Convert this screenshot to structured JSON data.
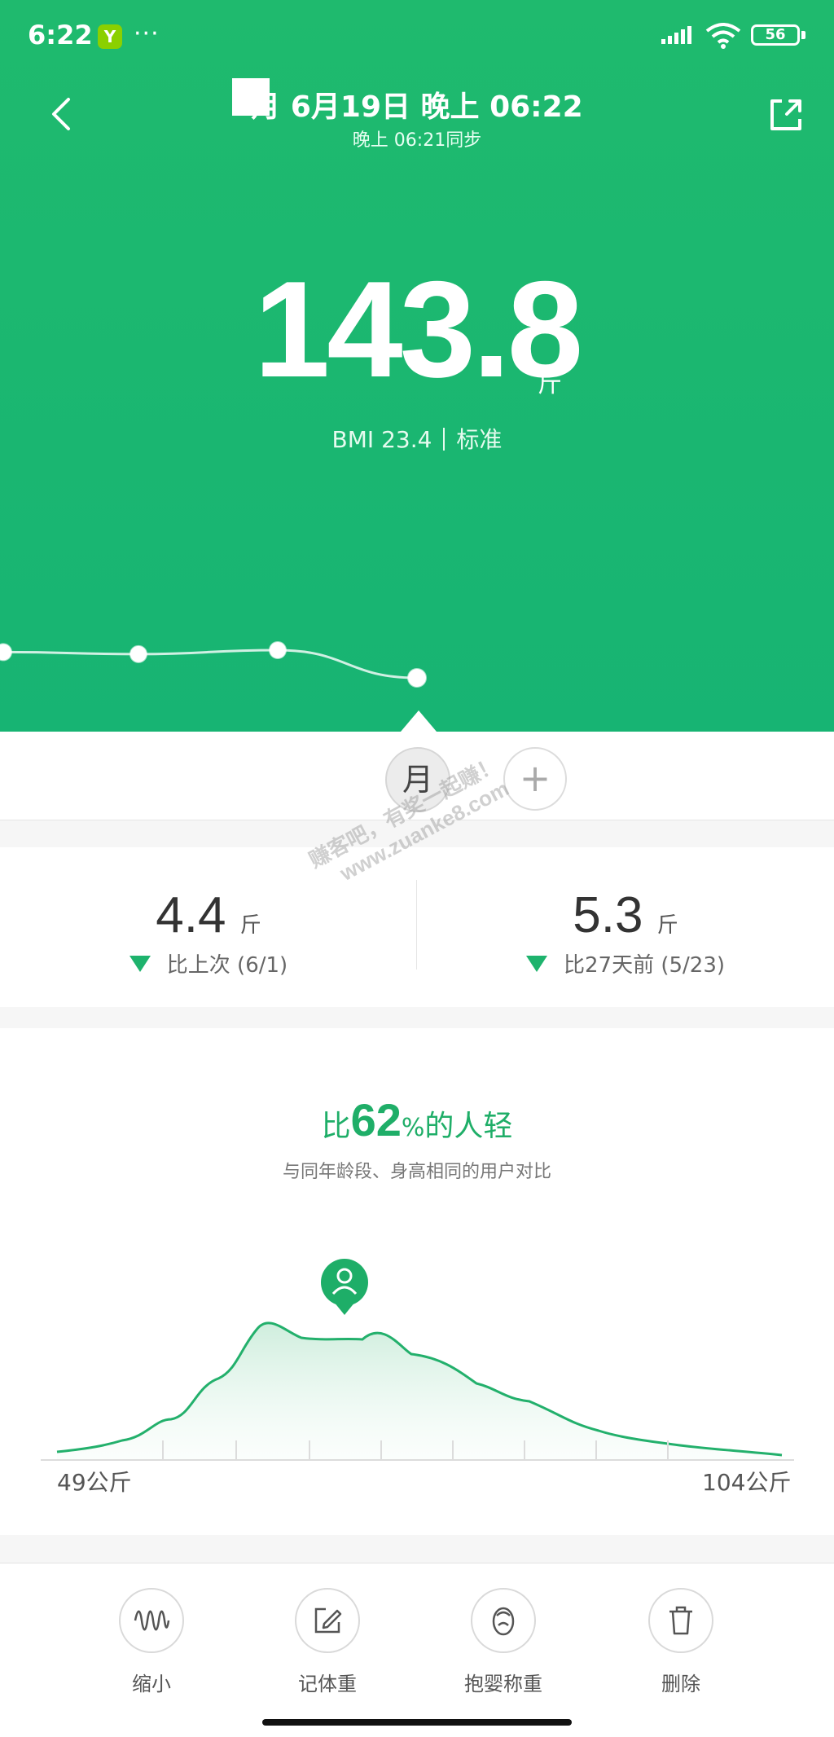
{
  "status_bar": {
    "time": "6:22",
    "app_badge": "Y",
    "more": "···",
    "battery": "56"
  },
  "header": {
    "title": "月 6月19日 晚上 06:22",
    "sync_text": "晚上 06:21同步"
  },
  "measurement": {
    "weight": "143.8",
    "unit": "斤",
    "bmi_label": "BMI 23.4",
    "bmi_status": "标准"
  },
  "trend": {
    "points": [
      {
        "label": "prev-3",
        "value": 146.4
      },
      {
        "label": "prev-2",
        "value": 146.2
      },
      {
        "label": "prev-1",
        "value": 146.6
      },
      {
        "label": "current",
        "value": 143.8
      }
    ]
  },
  "period": {
    "selected": "月",
    "add": "+"
  },
  "changes": [
    {
      "value": "4.4",
      "unit": "斤",
      "desc": "比上次 (6/1)"
    },
    {
      "value": "5.3",
      "unit": "斤",
      "desc": "比27天前 (5/23)"
    }
  ],
  "comparison": {
    "prefix": "比",
    "percent": "62",
    "percent_sign": "%",
    "suffix": "的人轻",
    "subtitle": "与同年龄段、身高相同的用户对比",
    "axis_min": "49公斤",
    "axis_max": "104公斤"
  },
  "toolbar": [
    {
      "label": "缩小",
      "icon": "wave-icon"
    },
    {
      "label": "记体重",
      "icon": "edit-icon"
    },
    {
      "label": "抱婴称重",
      "icon": "baby-icon"
    },
    {
      "label": "删除",
      "icon": "trash-icon"
    }
  ],
  "watermark": {
    "line1": "赚客吧，有奖一起赚！",
    "line2": "www.zuanke8.com"
  },
  "colors": {
    "brand_green": "#1fba6e",
    "accent_green": "#1eb36d",
    "text_dark": "#333333"
  }
}
